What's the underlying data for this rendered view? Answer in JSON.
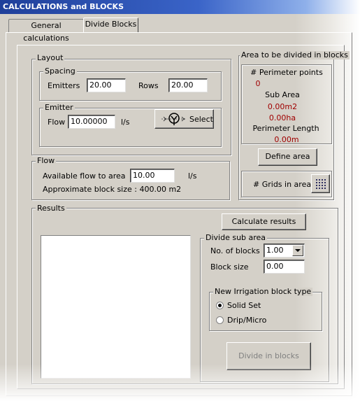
{
  "window": {
    "title": "CALCULATIONS and BLOCKS"
  },
  "tabs": [
    {
      "label": "General calculations",
      "active": false
    },
    {
      "label": "Divide Blocks",
      "active": true
    }
  ],
  "layout": {
    "title": "Layout",
    "spacing": {
      "title": "Spacing",
      "emitters_label": "Emitters",
      "emitters_value": "20.00",
      "rows_label": "Rows",
      "rows_value": "20.00"
    },
    "emitter": {
      "title": "Emitter",
      "flow_label": "Flow",
      "flow_value": "10.00000",
      "flow_unit": "l/s",
      "select_label": "Select",
      "select_icon": "sprinkler-icon"
    }
  },
  "flow": {
    "title": "Flow",
    "available_label": "Available flow to area",
    "available_value": "10.00",
    "available_unit": "l/s",
    "block_size_text": "Approximate block size : 400.00 m2"
  },
  "area": {
    "title": "Area to be divided in blocks",
    "perimeter_points_label": "# Perimeter points",
    "perimeter_points_value": "0",
    "sub_area_label": "Sub Area",
    "sub_area_m2": "0.00m2",
    "sub_area_ha": "0.00ha",
    "perimeter_length_label": "Perimeter Length",
    "perimeter_length_value": "0.00m",
    "define_area_label": "Define area",
    "grids_label": "# Grids in area",
    "grids_icon": "grid-icon",
    "value_color": "#a00000"
  },
  "results": {
    "title": "Results",
    "calculate_label": "Calculate results",
    "divide": {
      "title": "Divide sub area",
      "no_blocks_label": "No. of blocks",
      "no_blocks_value": "1.00",
      "block_size_label": "Block size",
      "block_size_value": "0.00",
      "block_type": {
        "title": "New Irrigation block type",
        "options": [
          {
            "label": "Solid Set",
            "selected": true
          },
          {
            "label": "Drip/Micro",
            "selected": false
          }
        ]
      },
      "divide_button_label": "Divide in blocks"
    }
  }
}
